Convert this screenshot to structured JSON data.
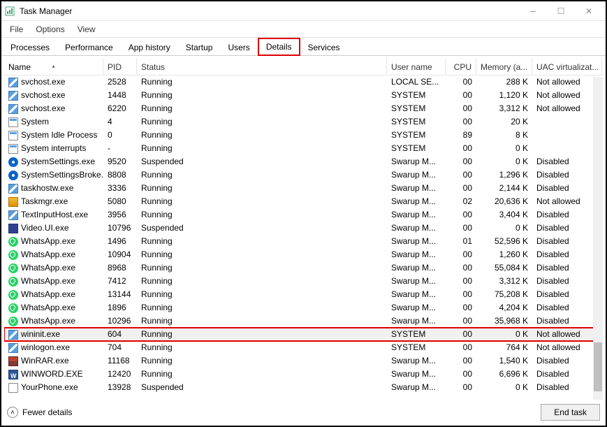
{
  "window": {
    "title": "Task Manager"
  },
  "menu": {
    "file": "File",
    "options": "Options",
    "view": "View"
  },
  "tabs": {
    "processes": "Processes",
    "performance": "Performance",
    "app_history": "App history",
    "startup": "Startup",
    "users": "Users",
    "details": "Details",
    "services": "Services"
  },
  "columns": {
    "name": "Name",
    "pid": "PID",
    "status": "Status",
    "user": "User name",
    "cpu": "CPU",
    "memory": "Memory (a...",
    "uac": "UAC virtualizat..."
  },
  "rows": [
    {
      "icon": "svc",
      "name": "svchost.exe",
      "pid": "2528",
      "status": "Running",
      "user": "LOCAL SE...",
      "cpu": "00",
      "mem": "288 K",
      "uac": "Not allowed"
    },
    {
      "icon": "svc",
      "name": "svchost.exe",
      "pid": "1448",
      "status": "Running",
      "user": "SYSTEM",
      "cpu": "00",
      "mem": "1,120 K",
      "uac": "Not allowed"
    },
    {
      "icon": "svc",
      "name": "svchost.exe",
      "pid": "6220",
      "status": "Running",
      "user": "SYSTEM",
      "cpu": "00",
      "mem": "3,312 K",
      "uac": "Not allowed"
    },
    {
      "icon": "sys",
      "name": "System",
      "pid": "4",
      "status": "Running",
      "user": "SYSTEM",
      "cpu": "00",
      "mem": "20 K",
      "uac": ""
    },
    {
      "icon": "sys",
      "name": "System Idle Process",
      "pid": "0",
      "status": "Running",
      "user": "SYSTEM",
      "cpu": "89",
      "mem": "8 K",
      "uac": ""
    },
    {
      "icon": "sys",
      "name": "System interrupts",
      "pid": "-",
      "status": "Running",
      "user": "SYSTEM",
      "cpu": "00",
      "mem": "0 K",
      "uac": ""
    },
    {
      "icon": "gear",
      "name": "SystemSettings.exe",
      "pid": "9520",
      "status": "Suspended",
      "user": "Swarup M...",
      "cpu": "00",
      "mem": "0 K",
      "uac": "Disabled"
    },
    {
      "icon": "gear",
      "name": "SystemSettingsBroke...",
      "pid": "8808",
      "status": "Running",
      "user": "Swarup M...",
      "cpu": "00",
      "mem": "1,296 K",
      "uac": "Disabled"
    },
    {
      "icon": "svc",
      "name": "taskhostw.exe",
      "pid": "3336",
      "status": "Running",
      "user": "Swarup M...",
      "cpu": "00",
      "mem": "2,144 K",
      "uac": "Disabled"
    },
    {
      "icon": "tm",
      "name": "Taskmgr.exe",
      "pid": "5080",
      "status": "Running",
      "user": "Swarup M...",
      "cpu": "02",
      "mem": "20,636 K",
      "uac": "Not allowed"
    },
    {
      "icon": "svc",
      "name": "TextInputHost.exe",
      "pid": "3956",
      "status": "Running",
      "user": "Swarup M...",
      "cpu": "00",
      "mem": "3,404 K",
      "uac": "Disabled"
    },
    {
      "icon": "vid",
      "name": "Video.UI.exe",
      "pid": "10796",
      "status": "Suspended",
      "user": "Swarup M...",
      "cpu": "00",
      "mem": "0 K",
      "uac": "Disabled"
    },
    {
      "icon": "wa",
      "name": "WhatsApp.exe",
      "pid": "1496",
      "status": "Running",
      "user": "Swarup M...",
      "cpu": "01",
      "mem": "52,596 K",
      "uac": "Disabled"
    },
    {
      "icon": "wa",
      "name": "WhatsApp.exe",
      "pid": "10904",
      "status": "Running",
      "user": "Swarup M...",
      "cpu": "00",
      "mem": "1,260 K",
      "uac": "Disabled"
    },
    {
      "icon": "wa",
      "name": "WhatsApp.exe",
      "pid": "8968",
      "status": "Running",
      "user": "Swarup M...",
      "cpu": "00",
      "mem": "55,084 K",
      "uac": "Disabled"
    },
    {
      "icon": "wa",
      "name": "WhatsApp.exe",
      "pid": "7412",
      "status": "Running",
      "user": "Swarup M...",
      "cpu": "00",
      "mem": "3,312 K",
      "uac": "Disabled"
    },
    {
      "icon": "wa",
      "name": "WhatsApp.exe",
      "pid": "13144",
      "status": "Running",
      "user": "Swarup M...",
      "cpu": "00",
      "mem": "75,208 K",
      "uac": "Disabled"
    },
    {
      "icon": "wa",
      "name": "WhatsApp.exe",
      "pid": "1896",
      "status": "Running",
      "user": "Swarup M...",
      "cpu": "00",
      "mem": "4,204 K",
      "uac": "Disabled"
    },
    {
      "icon": "wa",
      "name": "WhatsApp.exe",
      "pid": "10296",
      "status": "Running",
      "user": "Swarup M...",
      "cpu": "00",
      "mem": "35,968 K",
      "uac": "Disabled"
    },
    {
      "icon": "svc",
      "name": "wininit.exe",
      "pid": "604",
      "status": "Running",
      "user": "SYSTEM",
      "cpu": "00",
      "mem": "0 K",
      "uac": "Not allowed",
      "hl": true
    },
    {
      "icon": "svc",
      "name": "winlogon.exe",
      "pid": "704",
      "status": "Running",
      "user": "SYSTEM",
      "cpu": "00",
      "mem": "764 K",
      "uac": "Not allowed"
    },
    {
      "icon": "rar",
      "name": "WinRAR.exe",
      "pid": "11168",
      "status": "Running",
      "user": "Swarup M...",
      "cpu": "00",
      "mem": "1,540 K",
      "uac": "Disabled"
    },
    {
      "icon": "word",
      "name": "WINWORD.EXE",
      "pid": "12420",
      "status": "Running",
      "user": "Swarup M...",
      "cpu": "00",
      "mem": "6,696 K",
      "uac": "Disabled"
    },
    {
      "icon": "yp",
      "name": "YourPhone.exe",
      "pid": "13928",
      "status": "Suspended",
      "user": "Swarup M...",
      "cpu": "00",
      "mem": "0 K",
      "uac": "Disabled"
    }
  ],
  "footer": {
    "fewer": "Fewer details",
    "end": "End task"
  }
}
